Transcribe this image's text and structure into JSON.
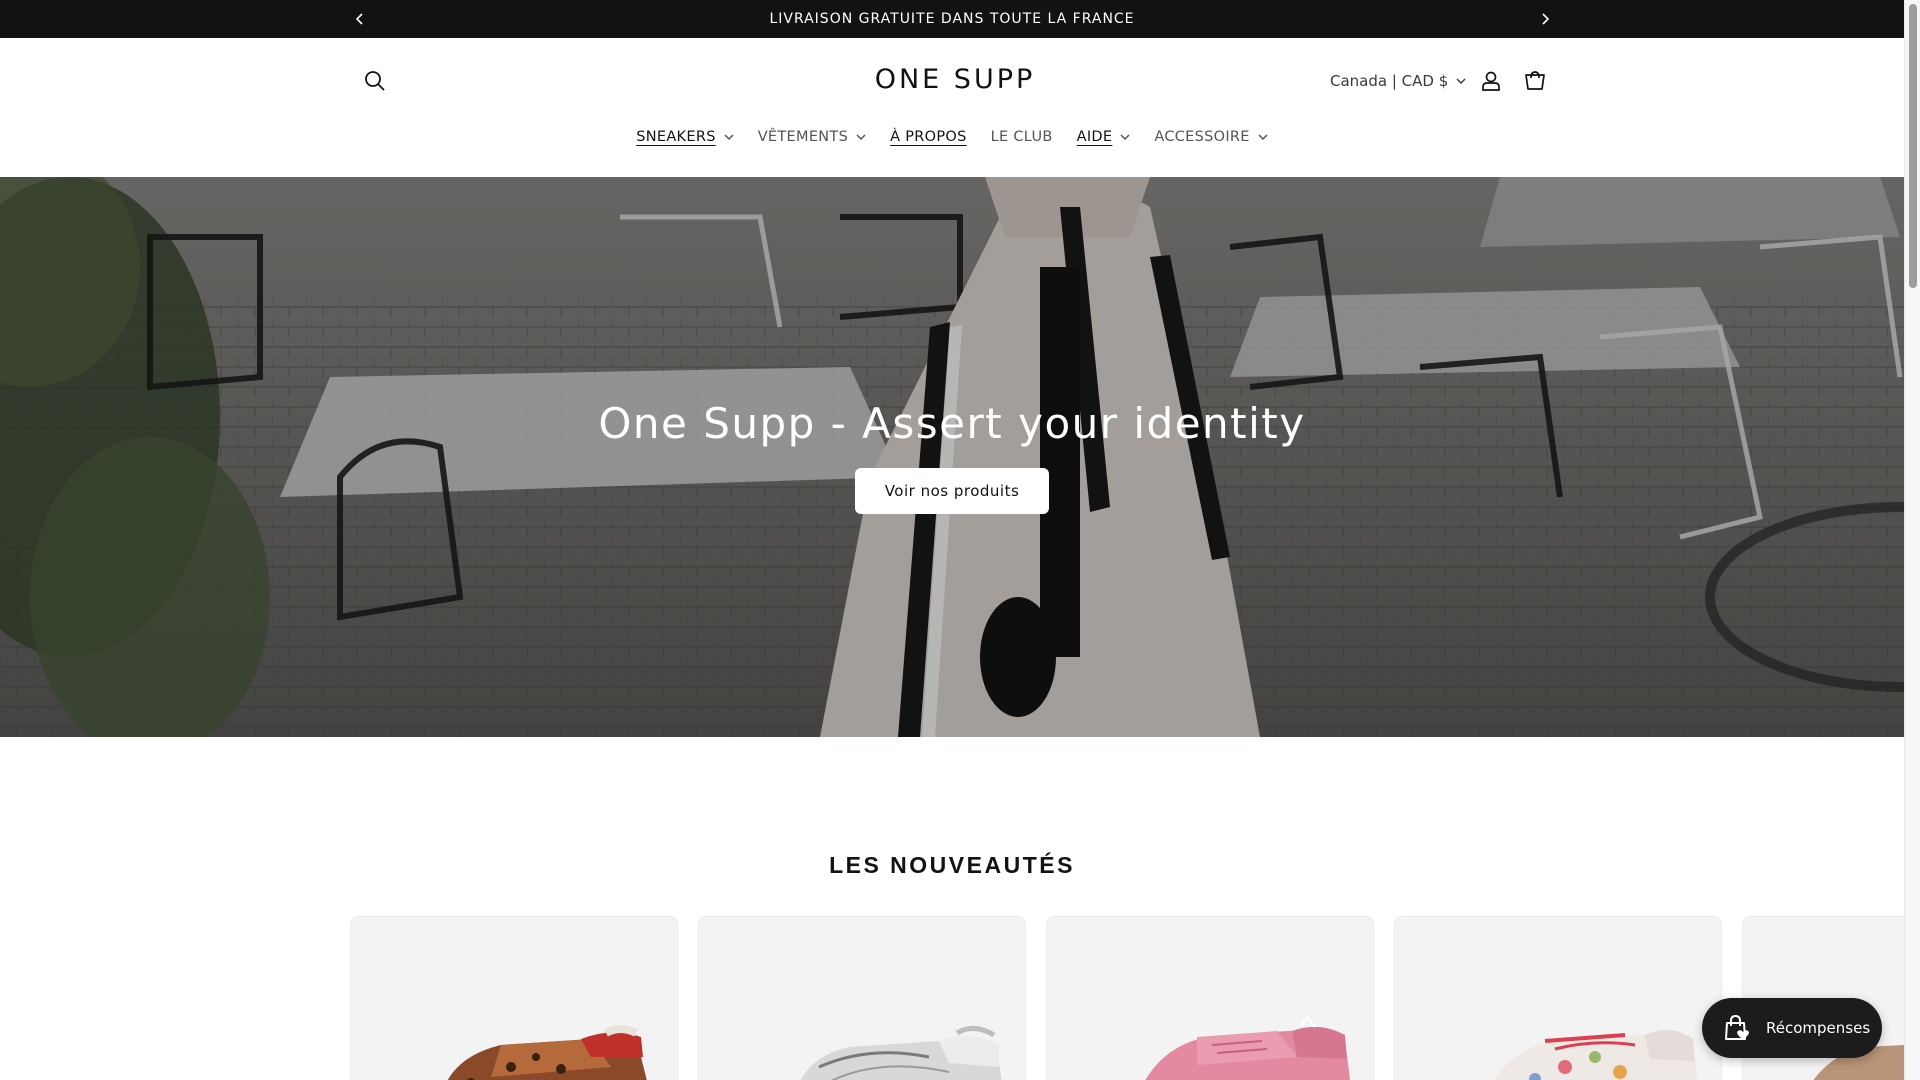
{
  "announcement": {
    "text": "LIVRAISON GRATUITE DANS TOUTE LA FRANCE"
  },
  "header": {
    "logo": "ONE SUPP",
    "currency_label": "Canada | CAD $",
    "nav": [
      {
        "label": "SNEAKERS",
        "has_dropdown": true
      },
      {
        "label": "VÊTEMENTS",
        "has_dropdown": true
      },
      {
        "label": "À PROPOS",
        "has_dropdown": false
      },
      {
        "label": "LE CLUB",
        "has_dropdown": false
      },
      {
        "label": "AIDE",
        "has_dropdown": true
      },
      {
        "label": "ACCESSOIRE",
        "has_dropdown": true
      }
    ]
  },
  "hero": {
    "title": "One Supp - Assert your identity",
    "button_label": "Voir nos produits"
  },
  "section": {
    "title": "LES NOUVEAUTÉS"
  },
  "products": [
    {
      "icon": "sneaker-leopard-red"
    },
    {
      "icon": "sneaker-silver-metallic"
    },
    {
      "icon": "sneaker-pink"
    },
    {
      "icon": "sneaker-white-floral"
    },
    {
      "icon": "sneaker-tan"
    }
  ],
  "rewards": {
    "label": "Récompenses"
  },
  "colors": {
    "announcement_bg": "#121212",
    "text": "#121212",
    "card_bg": "#f3f3f3",
    "rewards_bg": "#1c1c1c"
  }
}
